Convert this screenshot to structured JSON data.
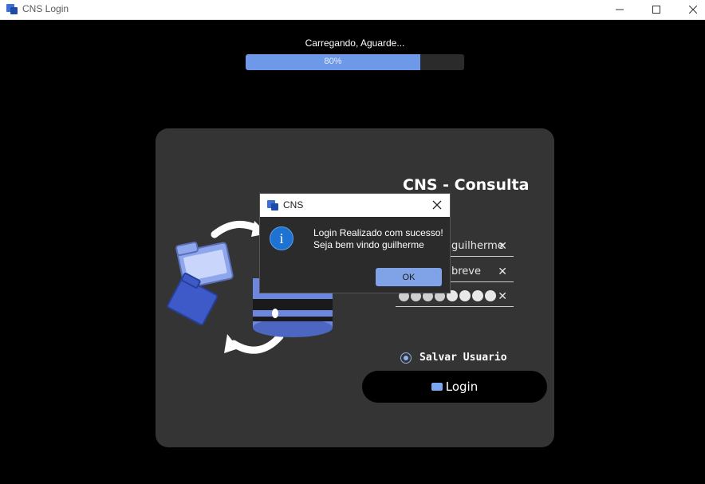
{
  "window": {
    "title": "CNS Login",
    "minimize_icon": "minimize-icon",
    "maximize_icon": "maximize-icon",
    "close_icon": "close-icon"
  },
  "loading": {
    "text": "Carregando, Aguarde...",
    "progress": 0.8,
    "progress_label": "80%"
  },
  "login_form": {
    "app_title": "CNS - Consulta",
    "username_value": "guilherme",
    "server_value": "breve",
    "password_dots": 8,
    "save_user_label": "Salvar Usuario",
    "save_user_checked": true,
    "login_button_label": "Login"
  },
  "dialog": {
    "title": "CNS",
    "message_line1": "Login Realizado com sucesso!",
    "message_line2": "Seja bem vindo guilherme",
    "ok_label": "OK",
    "icon": "info-icon"
  },
  "colors": {
    "accent": "#6d99e8",
    "card": "#343434",
    "background": "#000000"
  }
}
